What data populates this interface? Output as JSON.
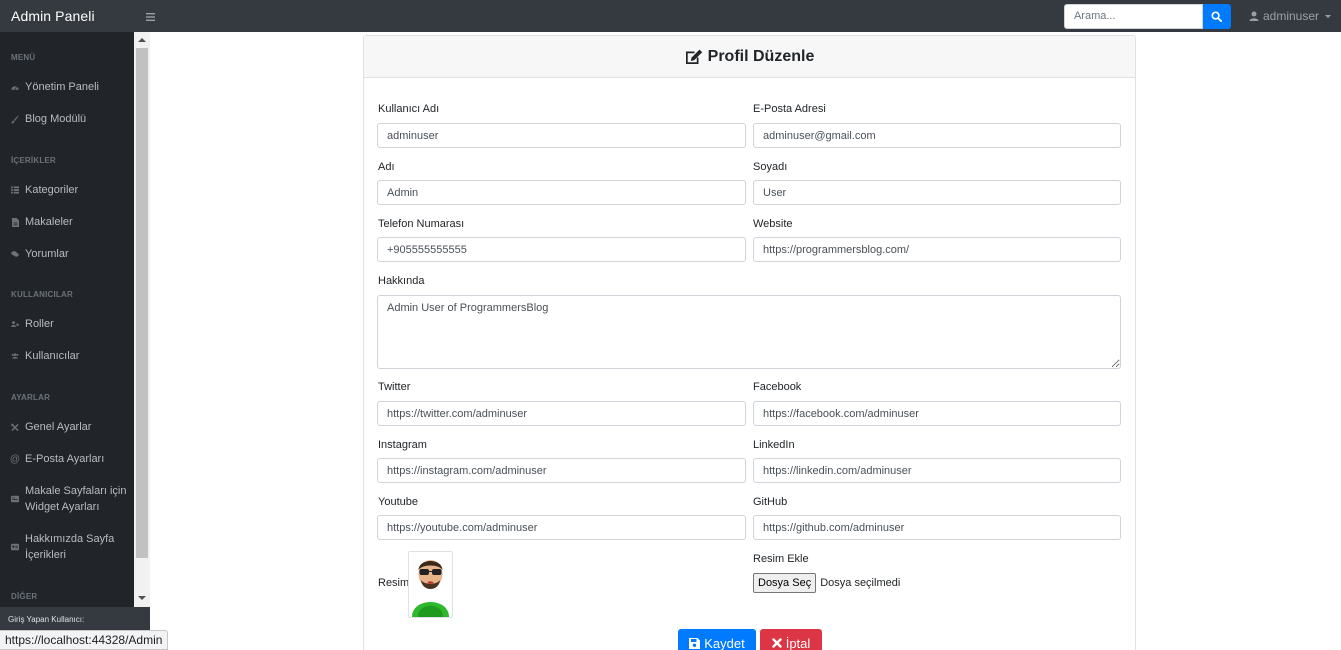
{
  "navbar": {
    "brand": "Admin Paneli",
    "search_placeholder": "Arama...",
    "user": "adminuser"
  },
  "sidebar": {
    "sections": [
      {
        "heading": "MENÜ",
        "items": [
          {
            "label": "Yönetim Paneli",
            "icon": "tachometer-icon"
          },
          {
            "label": "Blog Modülü",
            "icon": "paint-brush-icon"
          }
        ]
      },
      {
        "heading": "İÇERİKLER",
        "items": [
          {
            "label": "Kategoriler",
            "icon": "list-icon"
          },
          {
            "label": "Makaleler",
            "icon": "file-icon"
          },
          {
            "label": "Yorumlar",
            "icon": "comments-icon"
          }
        ]
      },
      {
        "heading": "KULLANICILAR",
        "items": [
          {
            "label": "Roller",
            "icon": "user-tag-icon"
          },
          {
            "label": "Kullanıcılar",
            "icon": "users-icon"
          }
        ]
      },
      {
        "heading": "AYARLAR",
        "items": [
          {
            "label": "Genel Ayarlar",
            "icon": "tools-icon"
          },
          {
            "label": "E-Posta Ayarları",
            "icon": "at-icon"
          },
          {
            "label": "Makale Sayfaları için Widget Ayarları",
            "icon": "widget-icon"
          },
          {
            "label": "Hakkımızda Sayfa İçerikleri",
            "icon": "id-card-icon"
          }
        ]
      },
      {
        "heading": "DİĞER",
        "items": []
      }
    ],
    "footer_label": "Giriş Yapan Kullanıcı:"
  },
  "status_url": "https://localhost:44328/Admin",
  "form": {
    "title": "Profil Düzenle",
    "username": {
      "label": "Kullanıcı Adı",
      "value": "adminuser"
    },
    "email": {
      "label": "E-Posta Adresi",
      "value": "adminuser@gmail.com"
    },
    "first_name": {
      "label": "Adı",
      "value": "Admin"
    },
    "last_name": {
      "label": "Soyadı",
      "value": "User"
    },
    "phone": {
      "label": "Telefon Numarası",
      "value": "+905555555555"
    },
    "website": {
      "label": "Website",
      "value": "https://programmersblog.com/"
    },
    "about": {
      "label": "Hakkında",
      "value": "Admin User of ProgrammersBlog"
    },
    "twitter": {
      "label": "Twitter",
      "value": "https://twitter.com/adminuser"
    },
    "facebook": {
      "label": "Facebook",
      "value": "https://facebook.com/adminuser"
    },
    "instagram": {
      "label": "Instagram",
      "value": "https://instagram.com/adminuser"
    },
    "linkedin": {
      "label": "LinkedIn",
      "value": "https://linkedin.com/adminuser"
    },
    "youtube": {
      "label": "Youtube",
      "value": "https://youtube.com/adminuser"
    },
    "github": {
      "label": "GitHub",
      "value": "https://github.com/adminuser"
    },
    "picture_label": "Resim",
    "add_picture_label": "Resim Ekle",
    "file_button": "Dosya Seç",
    "file_status": "Dosya seçilmedi",
    "save_label": "Kaydet",
    "cancel_label": "İptal"
  },
  "colors": {
    "primary": "#007bff",
    "danger": "#dc3545",
    "navbar": "#343a40",
    "sidebar": "#212529"
  }
}
